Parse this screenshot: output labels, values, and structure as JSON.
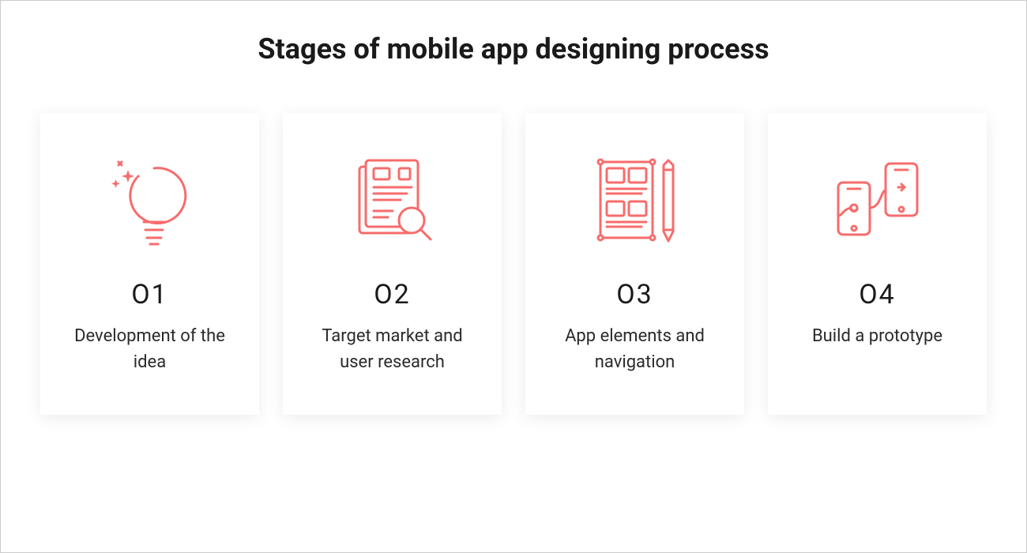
{
  "title": "Stages of mobile app designing process",
  "accent": "#f76c6c",
  "stages": [
    {
      "number": "O1",
      "description": "Development of the idea",
      "icon": "lightbulb-icon"
    },
    {
      "number": "O2",
      "description": "Target market and user research",
      "icon": "research-doc-icon"
    },
    {
      "number": "O3",
      "description": "App elements and navigation",
      "icon": "wireframe-icon"
    },
    {
      "number": "O4",
      "description": "Build a prototype",
      "icon": "prototype-icon"
    }
  ]
}
